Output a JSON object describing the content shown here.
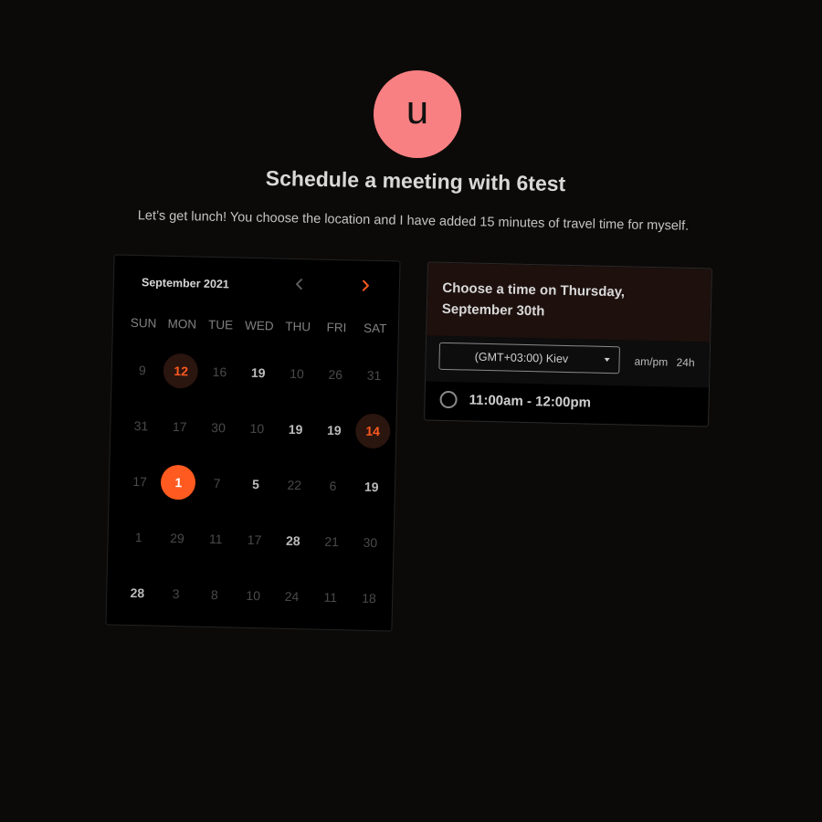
{
  "avatar": {
    "initial": "u",
    "color": "#f98082"
  },
  "header": {
    "title": "Schedule a meeting with 6test",
    "description": "Let’s get lunch! You choose the location and I have added 15 minutes of travel time for myself."
  },
  "calendar": {
    "month_label": "September 2021",
    "prev_icon": "chevron-left-icon",
    "next_icon": "chevron-right-icon",
    "accent": "#ff5a1f",
    "weekdays": [
      "SUN",
      "MON",
      "TUE",
      "WED",
      "THU",
      "FRI",
      "SAT"
    ],
    "days": [
      {
        "label": "9",
        "state": "disabled"
      },
      {
        "label": "12",
        "state": "highlight"
      },
      {
        "label": "16",
        "state": "disabled"
      },
      {
        "label": "19",
        "state": "available"
      },
      {
        "label": "10",
        "state": "disabled"
      },
      {
        "label": "26",
        "state": "disabled"
      },
      {
        "label": "31",
        "state": "disabled"
      },
      {
        "label": "31",
        "state": "disabled"
      },
      {
        "label": "17",
        "state": "disabled"
      },
      {
        "label": "30",
        "state": "disabled"
      },
      {
        "label": "10",
        "state": "disabled"
      },
      {
        "label": "19",
        "state": "available"
      },
      {
        "label": "19",
        "state": "available"
      },
      {
        "label": "14",
        "state": "highlight"
      },
      {
        "label": "17",
        "state": "disabled"
      },
      {
        "label": "1",
        "state": "selected"
      },
      {
        "label": "7",
        "state": "disabled"
      },
      {
        "label": "5",
        "state": "available"
      },
      {
        "label": "22",
        "state": "disabled"
      },
      {
        "label": "6",
        "state": "disabled"
      },
      {
        "label": "19",
        "state": "available"
      },
      {
        "label": "1",
        "state": "disabled"
      },
      {
        "label": "29",
        "state": "disabled"
      },
      {
        "label": "11",
        "state": "disabled"
      },
      {
        "label": "17",
        "state": "disabled"
      },
      {
        "label": "28",
        "state": "available"
      },
      {
        "label": "21",
        "state": "disabled"
      },
      {
        "label": "30",
        "state": "disabled"
      },
      {
        "label": "28",
        "state": "available"
      },
      {
        "label": "3",
        "state": "disabled"
      },
      {
        "label": "8",
        "state": "disabled"
      },
      {
        "label": "10",
        "state": "disabled"
      },
      {
        "label": "24",
        "state": "disabled"
      },
      {
        "label": "11",
        "state": "disabled"
      },
      {
        "label": "18",
        "state": "disabled"
      }
    ]
  },
  "time_panel": {
    "heading": "Choose a time on Thursday, September 30th",
    "timezone_value": "(GMT+03:00) Kiev",
    "format_ampm": "am/pm",
    "format_24h": "24h",
    "slots": [
      "11:00am - 12:00pm"
    ]
  }
}
